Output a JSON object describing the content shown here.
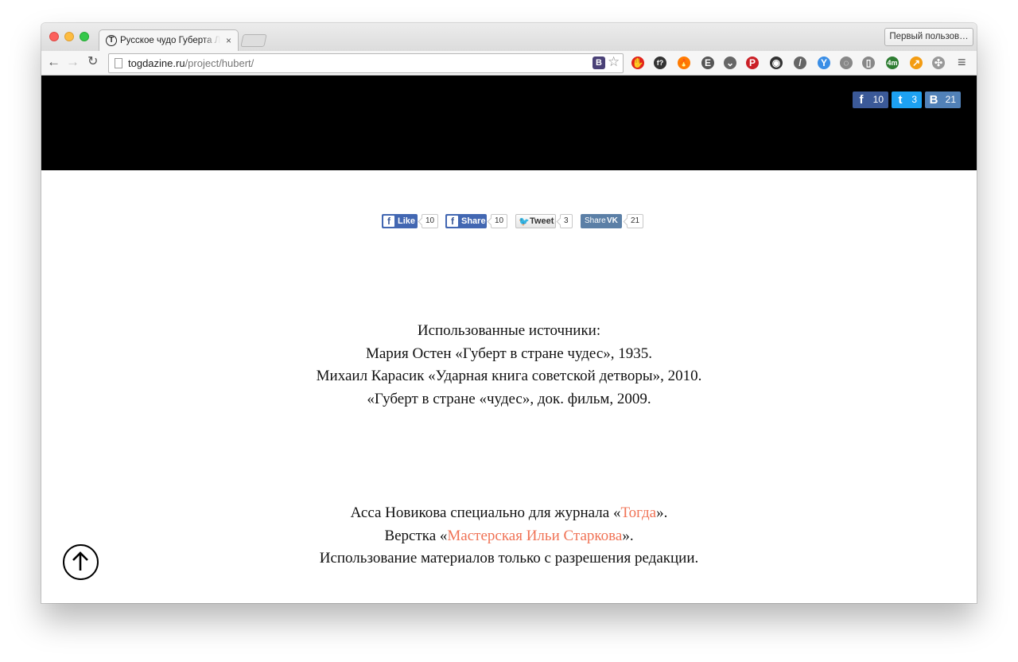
{
  "browser": {
    "tab_title": "Русское чудо Губерта Ло…",
    "tab_favicon": "Т",
    "tab_close": "×",
    "profile_button": "Первый пользов…",
    "url_host": "togdazine.ru",
    "url_path": "/project/hubert/",
    "omnibox_badge": "B",
    "nav": {
      "back": "←",
      "forward": "→",
      "reload": "↻"
    },
    "extensions": [
      {
        "name": "adblock-icon",
        "glyph": "✋",
        "color": "#e2231a"
      },
      {
        "name": "font-finder-icon",
        "glyph": "f?",
        "color": "#333333"
      },
      {
        "name": "fire-icon",
        "glyph": "🔥",
        "color": "#ff7b00"
      },
      {
        "name": "evernote-icon",
        "glyph": "E",
        "color": "#555555"
      },
      {
        "name": "pocket-icon",
        "glyph": "⌄",
        "color": "#666666"
      },
      {
        "name": "pinterest-icon",
        "glyph": "P",
        "color": "#cb2027"
      },
      {
        "name": "camera-icon",
        "glyph": "◉",
        "color": "#333333"
      },
      {
        "name": "eyedropper-icon",
        "glyph": "/",
        "color": "#666666"
      },
      {
        "name": "y-icon",
        "glyph": "Y",
        "color": "#3a8ee6"
      },
      {
        "name": "loading-icon",
        "glyph": "◌",
        "color": "#888888"
      },
      {
        "name": "reader-icon",
        "glyph": "▯",
        "color": "#888888"
      },
      {
        "name": "timer-icon",
        "glyph": "4m",
        "color": "#2e7d32"
      },
      {
        "name": "analytics-icon",
        "glyph": "↗",
        "color": "#f39c12"
      },
      {
        "name": "paw-icon",
        "glyph": "✣",
        "color": "#999999"
      }
    ],
    "menu_icon": "≡"
  },
  "top_share": {
    "facebook": {
      "icon": "f",
      "count": "10"
    },
    "twitter": {
      "icon": "t",
      "count": "3"
    },
    "vk": {
      "icon": "В",
      "count": "21"
    }
  },
  "share_buttons": {
    "like": {
      "label": "Like",
      "count": "10"
    },
    "share": {
      "label": "Share",
      "count": "10"
    },
    "tweet": {
      "label": "Tweet",
      "count": "3"
    },
    "vk_share": {
      "label": "Share",
      "mark": "VK",
      "count": "21"
    }
  },
  "sources": {
    "heading": "Использованные источники:",
    "items": [
      "Мария Остен «Губерт в стране чудес», 1935.",
      "Михаил Карасик «Ударная книга советской детворы», 2010.",
      "«Губерт в стране «чудес», док. фильм, 2009."
    ]
  },
  "credits": {
    "line1_prefix": "Асса Новикова специально для журнала «",
    "line1_link": "Тогда",
    "line1_suffix": "».",
    "line2_prefix": "Верстка «",
    "line2_link": "Мастерская Ильи Старкова",
    "line2_suffix": "».",
    "line3": "Использование материалов только с разрешения редакции."
  },
  "colors": {
    "link": "#f07356",
    "hero_background": "#000000",
    "facebook": "#3b5998",
    "twitter": "#1da1f2",
    "vk": "#5181b8"
  }
}
